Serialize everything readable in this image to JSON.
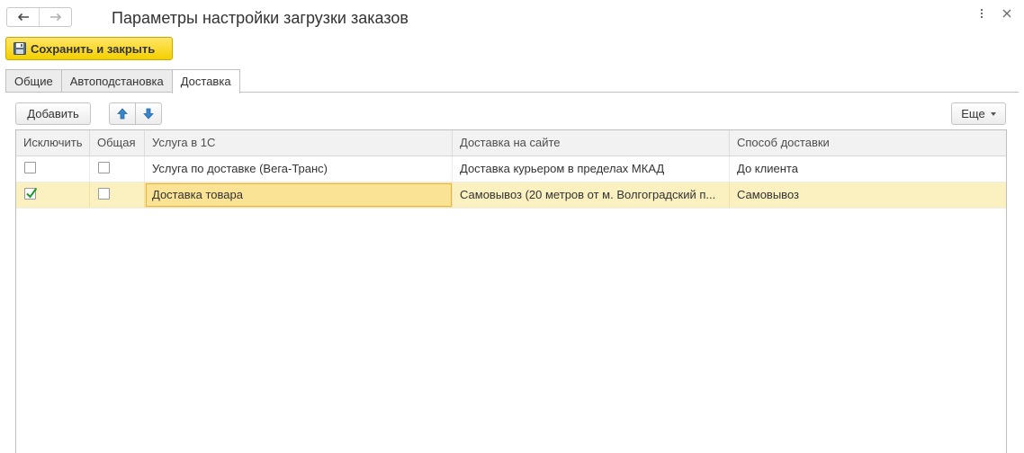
{
  "window": {
    "title": "Параметры настройки загрузки заказов"
  },
  "toolbar": {
    "save_label": "Сохранить и закрыть"
  },
  "tabs": [
    {
      "label": "Общие",
      "active": false
    },
    {
      "label": "Автоподстановка",
      "active": false
    },
    {
      "label": "Доставка",
      "active": true
    }
  ],
  "delivery_toolbar": {
    "add_label": "Добавить",
    "more_label": "Еще"
  },
  "table": {
    "columns": [
      "Исключить",
      "Общая",
      "Услуга в 1С",
      "Доставка на сайте",
      "Способ доставки"
    ],
    "rows": [
      {
        "exclude": false,
        "common": false,
        "service": "Услуга по доставке (Вега-Транс)",
        "site_delivery": "Доставка курьером в пределах МКАД",
        "method": "До клиента"
      },
      {
        "exclude": true,
        "common": false,
        "service": "Доставка товара",
        "site_delivery": "Самовывоз (20 метров от м. Волгоградский п...",
        "method": "Самовывоз"
      }
    ]
  },
  "colors": {
    "accent_yellow": "#f4d000",
    "selected_row": "#fbf0bf",
    "focused_cell": "#fbe396",
    "arrow_blue": "#3a86c8",
    "check_green": "#1a9a2a"
  }
}
